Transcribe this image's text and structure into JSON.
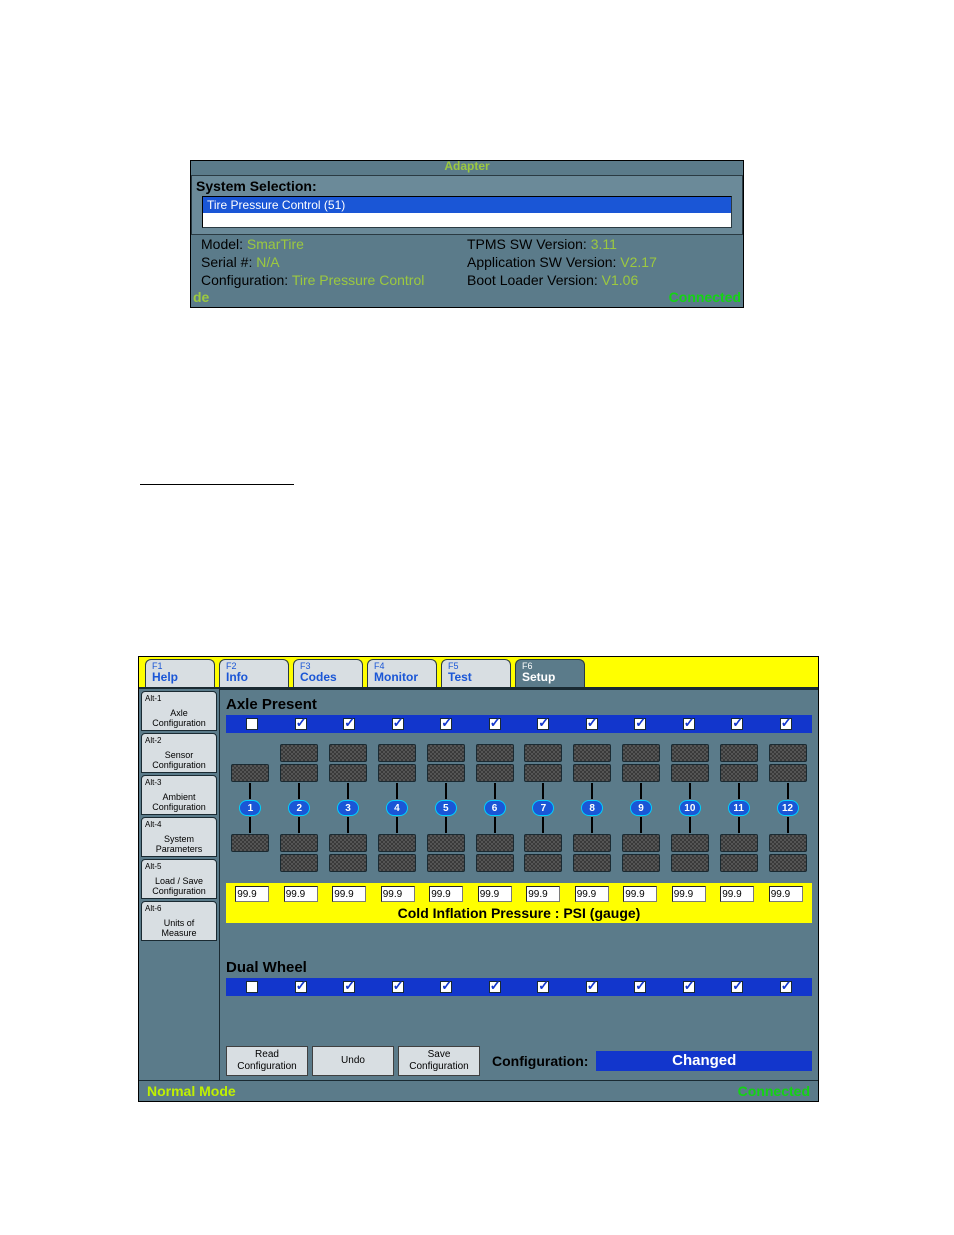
{
  "panel1": {
    "header": "Adapter",
    "syssel_label": "System Selection:",
    "syssel_item": "Tire Pressure Control (51)",
    "rows": [
      {
        "l": "Model:",
        "lv": "SmarTire",
        "r": "TPMS SW Version:",
        "rv": "3.11"
      },
      {
        "l": "Serial #:",
        "lv": "N/A",
        "r": "Application SW Version:",
        "rv": "V2.17"
      },
      {
        "l": "Configuration:",
        "lv": "Tire Pressure Control",
        "r": "Boot Loader Version:",
        "rv": "V1.06"
      }
    ],
    "status_left": "de",
    "status_right": "Connected"
  },
  "tabs": [
    {
      "fk": "F1",
      "label": "Help"
    },
    {
      "fk": "F2",
      "label": "Info"
    },
    {
      "fk": "F3",
      "label": "Codes"
    },
    {
      "fk": "F4",
      "label": "Monitor"
    },
    {
      "fk": "F5",
      "label": "Test"
    },
    {
      "fk": "F6",
      "label": "Setup"
    }
  ],
  "active_tab": 5,
  "sidebar": [
    {
      "ak": "Alt-1",
      "label": "Axle Configuration"
    },
    {
      "ak": "Alt-2",
      "label": "Sensor Configuration"
    },
    {
      "ak": "Alt-3",
      "label": "Ambient Configuration"
    },
    {
      "ak": "Alt-4",
      "label": "System Parameters"
    },
    {
      "ak": "Alt-5",
      "label": "Load / Save Configuration"
    },
    {
      "ak": "Alt-6",
      "label": "Units of Measure"
    }
  ],
  "sections": {
    "axle_present": "Axle Present",
    "dual_wheel": "Dual Wheel",
    "cip_label": "Cold Inflation Pressure : PSI (gauge)"
  },
  "axle_present_checks": [
    false,
    true,
    true,
    true,
    true,
    true,
    true,
    true,
    true,
    true,
    true,
    true
  ],
  "dual_wheel_checks": [
    false,
    true,
    true,
    true,
    true,
    true,
    true,
    true,
    true,
    true,
    true,
    true
  ],
  "axle_numbers": [
    "1",
    "2",
    "3",
    "4",
    "5",
    "6",
    "7",
    "8",
    "9",
    "10",
    "11",
    "12"
  ],
  "psi_values": [
    "99.9",
    "99.9",
    "99.9",
    "99.9",
    "99.9",
    "99.9",
    "99.9",
    "99.9",
    "99.9",
    "99.9",
    "99.9",
    "99.9"
  ],
  "buttons": {
    "read": "Read Configuration",
    "undo": "Undo",
    "save": "Save Configuration"
  },
  "config_label": "Configuration:",
  "config_status": "Changed",
  "status2_left": "Normal Mode",
  "status2_right": "Connected"
}
